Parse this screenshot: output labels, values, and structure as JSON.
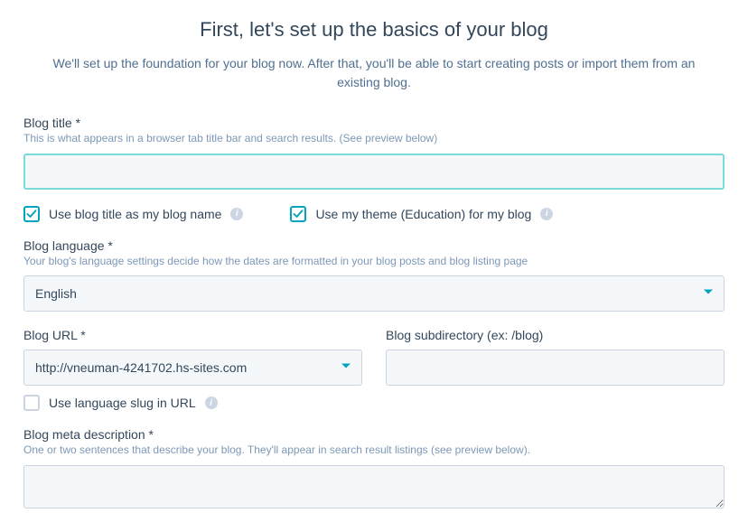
{
  "header": {
    "title": "First, let's set up the basics of your blog",
    "subtitle": "We'll set up the foundation for your blog now. After that, you'll be able to start creating posts or import them from an existing blog."
  },
  "fields": {
    "blogTitle": {
      "label": "Blog title *",
      "help": "This is what appears in a browser tab title bar and search results. (See preview below)",
      "value": ""
    },
    "useTitleAsName": {
      "label": "Use blog title as my blog name",
      "checked": true
    },
    "useTheme": {
      "label": "Use my theme (Education) for my blog",
      "checked": true
    },
    "blogLanguage": {
      "label": "Blog language *",
      "help": "Your blog's language settings decide how the dates are formatted in your blog posts and blog listing page",
      "value": "English"
    },
    "blogUrl": {
      "label": "Blog URL *",
      "value": "http://vneuman-4241702.hs-sites.com"
    },
    "blogSubdirectory": {
      "label": "Blog subdirectory (ex: /blog)",
      "value": ""
    },
    "useLangSlug": {
      "label": "Use language slug in URL",
      "checked": false
    },
    "metaDescription": {
      "label": "Blog meta description *",
      "help": "One or two sentences that describe your blog. They'll appear in search result listings (see preview below).",
      "value": ""
    }
  },
  "colors": {
    "accent": "#00a4bd"
  }
}
